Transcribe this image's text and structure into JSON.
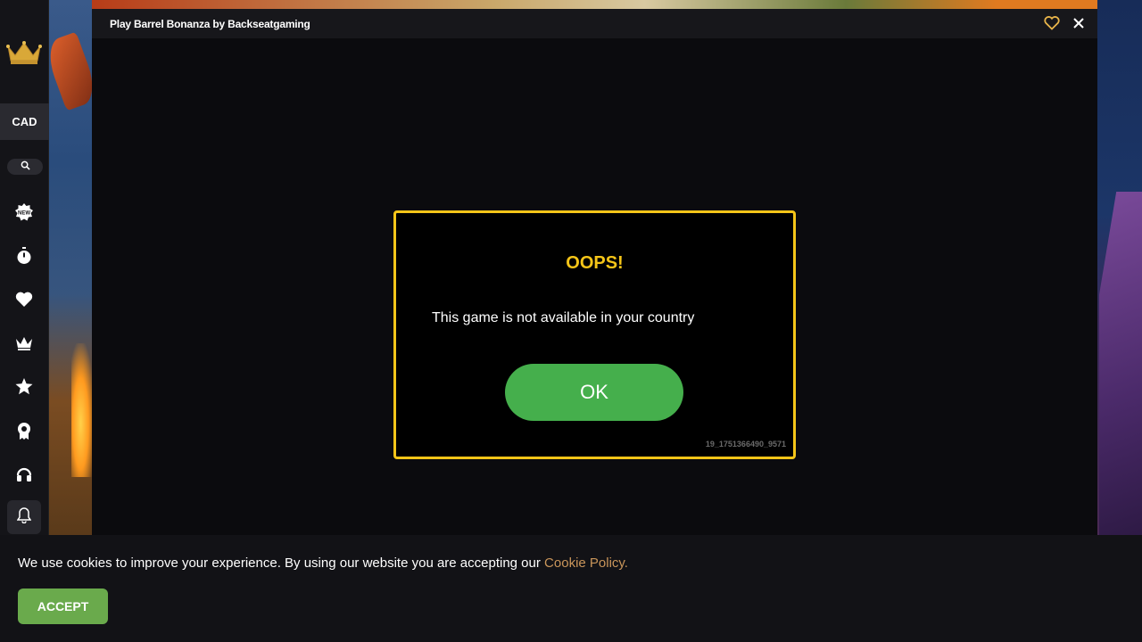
{
  "sidebar": {
    "currency": "CAD",
    "icons": [
      "crown-logo-icon",
      "search-icon",
      "new-badge-icon",
      "stopwatch-icon",
      "heart-icon",
      "crown-icon",
      "star-icon",
      "award-icon",
      "headset-icon",
      "bell-icon"
    ]
  },
  "game": {
    "title": "Play Barrel Bonanza by Backseatgaming"
  },
  "dialog": {
    "title": "OOPS!",
    "message": "This game is not available in your country",
    "ok_label": "OK",
    "error_code": "19_1751366490_9571"
  },
  "cookie": {
    "text": "We use cookies to improve your experience. By using our website you are accepting our ",
    "link": "Cookie Policy.",
    "accept_label": "ACCEPT"
  },
  "colors": {
    "accent_yellow": "#f5c518",
    "ok_green": "#45af4c",
    "accept_green": "#6aaa4c",
    "link_color": "#c9955a"
  }
}
